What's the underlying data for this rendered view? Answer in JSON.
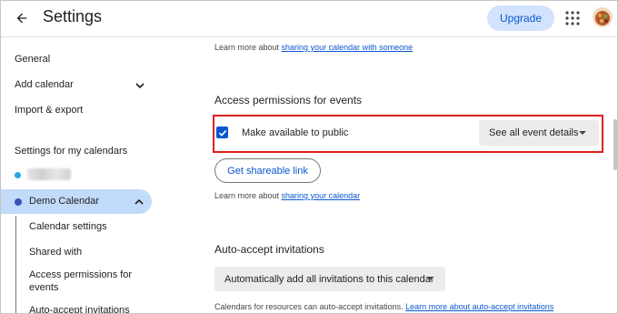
{
  "header": {
    "title": "Settings",
    "upgrade_label": "Upgrade"
  },
  "sidebar": {
    "items": [
      {
        "label": "General"
      },
      {
        "label": "Add calendar"
      },
      {
        "label": "Import & export"
      }
    ],
    "section_title": "Settings for my calendars",
    "calendars": [
      {
        "label": "",
        "color": "#24a8e0"
      },
      {
        "label": "Demo Calendar",
        "color": "#3f51b5"
      }
    ],
    "sub_items": [
      {
        "label": "Calendar settings"
      },
      {
        "label": "Shared with"
      },
      {
        "label": "Access permissions for"
      },
      {
        "label": "events"
      },
      {
        "label": "Auto-accept invitations"
      }
    ]
  },
  "main": {
    "top_note_prefix": "Learn more about ",
    "top_note_link": "sharing your calendar with someone",
    "access_heading": "Access permissions for events",
    "public_checkbox_label": "Make available to public",
    "public_checked": true,
    "event_details_select": "See all event details",
    "shareable_link_label": "Get shareable link",
    "share_note_prefix": "Learn more about ",
    "share_note_link": "sharing your calendar",
    "auto_accept_heading": "Auto-accept invitations",
    "auto_accept_select": "Automatically add all invitations to this calendar",
    "resources_note": "Calendars for resources can auto-accept invitations. ",
    "resources_link": "Learn more about auto-accept invitations"
  },
  "colors": {
    "accent": "#0b57d0",
    "selected_bg": "#c2dbfa",
    "highlight_border": "#e0201b"
  },
  "icons": {
    "back": "arrow-back-icon",
    "apps": "apps-grid-icon",
    "expand": "chevron-down-icon",
    "collapse": "chevron-up-icon",
    "dropdown": "caret-down-icon",
    "check": "check-icon"
  }
}
